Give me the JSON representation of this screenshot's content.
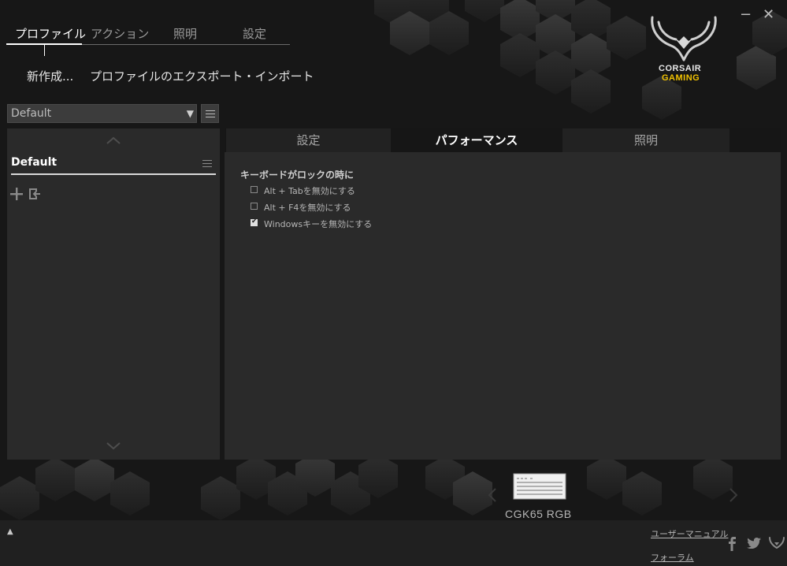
{
  "window": {
    "minimize_glyph": "−",
    "close_glyph": "✕"
  },
  "logo": {
    "line1": "CORSAIR",
    "line2": "GAMING",
    "accent_color": "#f2c200"
  },
  "nav": {
    "tabs": [
      {
        "label": "プロファイル",
        "active": true
      },
      {
        "label": "アクション",
        "active": false
      },
      {
        "label": "照明",
        "active": false
      },
      {
        "label": "設定",
        "active": false
      }
    ],
    "sub": {
      "new": "新作成...",
      "export_import": "プロファイルのエクスポート・インポート"
    }
  },
  "profile_select": {
    "value": "Default",
    "arrow": "▼"
  },
  "profile_list": {
    "items": [
      {
        "name": "Default",
        "active": true
      }
    ],
    "add_icon": "plus-icon",
    "import_icon": "import-icon"
  },
  "settings_tabs": [
    {
      "label": "設定",
      "active": false
    },
    {
      "label": "パフォーマンス",
      "active": true
    },
    {
      "label": "照明",
      "active": false
    }
  ],
  "performance": {
    "section_title": "キーボードがロックの時に",
    "options": [
      {
        "label": "Alt + Tabを無効にする",
        "checked": false
      },
      {
        "label": "Alt + F4を無効にする",
        "checked": false
      },
      {
        "label": "Windowsキーを無効にする",
        "checked": true
      }
    ]
  },
  "device": {
    "name": "CGK65 RGB",
    "icon": "keyboard-icon"
  },
  "footer": {
    "expand_glyph": "▲",
    "user_manual": "ユーザーマニュアル",
    "forum": "フォーラム",
    "social": [
      "facebook-icon",
      "twitter-icon",
      "corsair-icon"
    ]
  }
}
